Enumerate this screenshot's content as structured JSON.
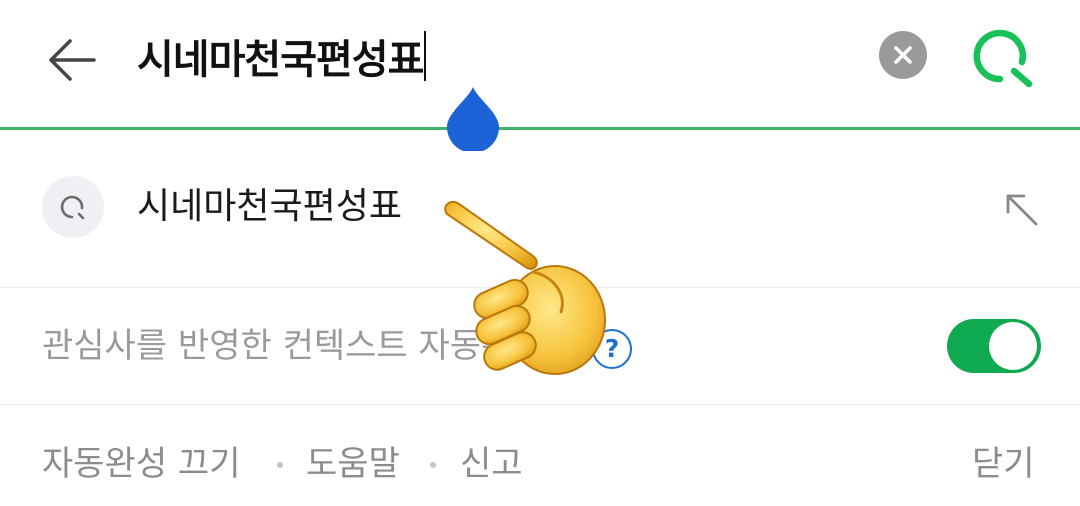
{
  "search": {
    "query": "시네마천국편성표"
  },
  "suggestion": {
    "text": "시네마천국편성표"
  },
  "context_setting": {
    "label": "관심사를 반영한 컨텍스트 자동완성",
    "toggle_on": true
  },
  "footer": {
    "disable": "자동완성 끄기",
    "help": "도움말",
    "report": "신고",
    "close": "닫기"
  },
  "colors": {
    "brand_green": "#0fa950",
    "underline_green": "#41b06a",
    "handle_blue": "#1b63d6",
    "help_blue": "#1d6fd1"
  },
  "icons": {
    "back": "arrow-left-icon",
    "clear": "close-circle-icon",
    "search": "search-icon",
    "insert": "arrow-up-left-icon",
    "help": "question-circle-icon"
  }
}
